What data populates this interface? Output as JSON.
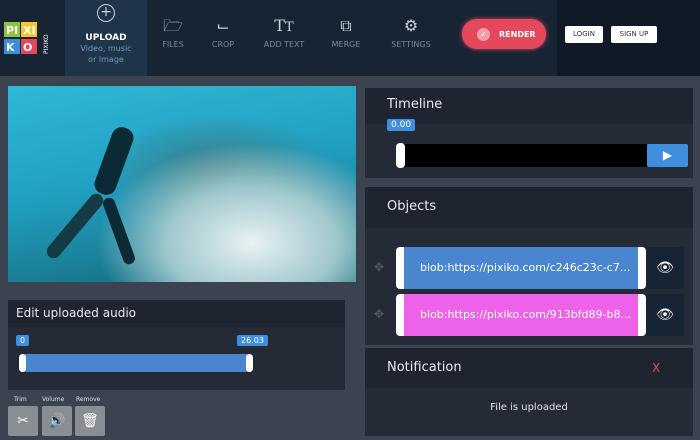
{
  "header": {
    "logo_text": [
      "PI",
      "XI",
      "KO",
      "PIXIKO"
    ],
    "nav": [
      {
        "icon": "plus-circle-icon",
        "label": "UPLOAD",
        "sub": "Video, music or image"
      },
      {
        "icon": "folder-icon",
        "label": "FILES"
      },
      {
        "icon": "crop-icon",
        "label": "CROP"
      },
      {
        "icon": "text-icon",
        "label": "ADD TEXT"
      },
      {
        "icon": "merge-icon",
        "label": "MERGE"
      },
      {
        "icon": "gear-icon",
        "label": "SETTINGS"
      }
    ],
    "render": "RENDER",
    "login": "LOGIN",
    "signup": "SIGN UP"
  },
  "audio": {
    "title": "Edit uploaded audio",
    "start": "0",
    "end": "26.03",
    "tools": [
      {
        "label": "Trim",
        "icon": "scissors-icon"
      },
      {
        "label": "Volume",
        "icon": "speaker-icon"
      },
      {
        "label": "Remove",
        "icon": "trash-icon"
      }
    ]
  },
  "timeline": {
    "title": "Timeline",
    "position": "0.00"
  },
  "objects": {
    "title": "Objects",
    "items": [
      {
        "label": "blob:https://pixiko.com/c246c23c-c7...",
        "color": "#4a86d0"
      },
      {
        "label": "blob:https://pixiko.com/913bfd89-b8...",
        "color": "#ee62ea"
      }
    ]
  },
  "notification": {
    "title": "Notification",
    "close": "X",
    "message": "File is uploaded"
  }
}
